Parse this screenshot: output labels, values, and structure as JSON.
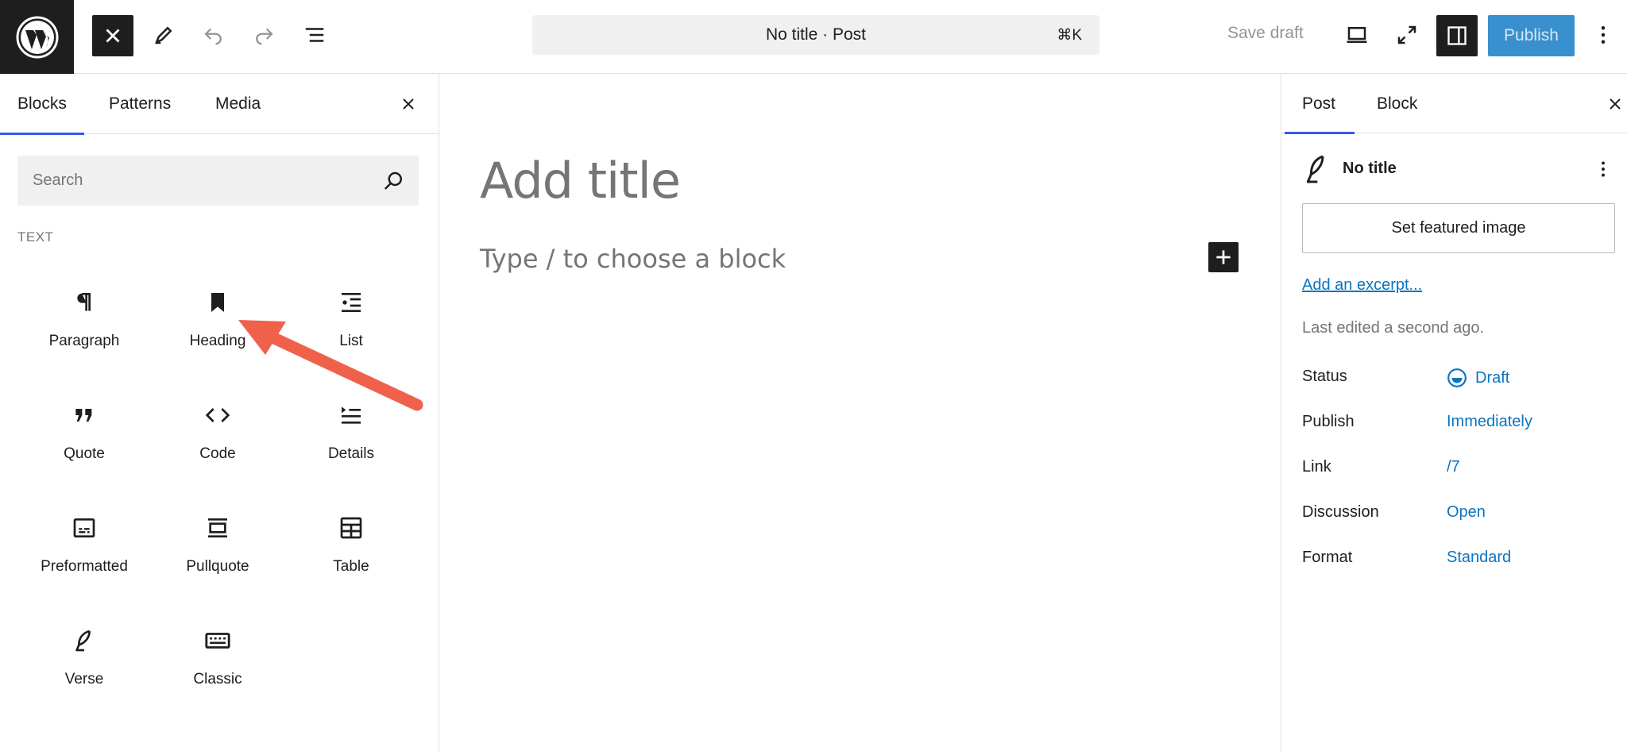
{
  "header": {
    "document_title": "No title · Post",
    "shortcut": "⌘K",
    "save_draft": "Save draft",
    "publish": "Publish"
  },
  "inserter": {
    "tabs": [
      {
        "label": "Blocks",
        "active": true
      },
      {
        "label": "Patterns",
        "active": false
      },
      {
        "label": "Media",
        "active": false
      }
    ],
    "search_placeholder": "Search",
    "section_label": "TEXT",
    "blocks": [
      {
        "label": "Paragraph",
        "icon": "paragraph-icon"
      },
      {
        "label": "Heading",
        "icon": "heading-icon"
      },
      {
        "label": "List",
        "icon": "list-icon"
      },
      {
        "label": "Quote",
        "icon": "quote-icon"
      },
      {
        "label": "Code",
        "icon": "code-icon"
      },
      {
        "label": "Details",
        "icon": "details-icon"
      },
      {
        "label": "Preformatted",
        "icon": "preformatted-icon"
      },
      {
        "label": "Pullquote",
        "icon": "pullquote-icon"
      },
      {
        "label": "Table",
        "icon": "table-icon"
      },
      {
        "label": "Verse",
        "icon": "verse-icon"
      },
      {
        "label": "Classic",
        "icon": "classic-icon"
      }
    ]
  },
  "canvas": {
    "title_placeholder": "Add title",
    "block_placeholder": "Type / to choose a block"
  },
  "settings": {
    "tabs": [
      {
        "label": "Post",
        "active": true
      },
      {
        "label": "Block",
        "active": false
      }
    ],
    "post_title": "No title",
    "featured_image": "Set featured image",
    "excerpt_link": "Add an excerpt...",
    "last_edited": "Last edited a second ago.",
    "meta": [
      {
        "label": "Status",
        "value": "Draft"
      },
      {
        "label": "Publish",
        "value": "Immediately"
      },
      {
        "label": "Link",
        "value": "/7"
      },
      {
        "label": "Discussion",
        "value": "Open"
      },
      {
        "label": "Format",
        "value": "Standard"
      }
    ]
  },
  "colors": {
    "accent": "#3858e9",
    "link": "#0a74c0",
    "publish_bg": "#3a8fce",
    "arrow": "#f0614b"
  }
}
